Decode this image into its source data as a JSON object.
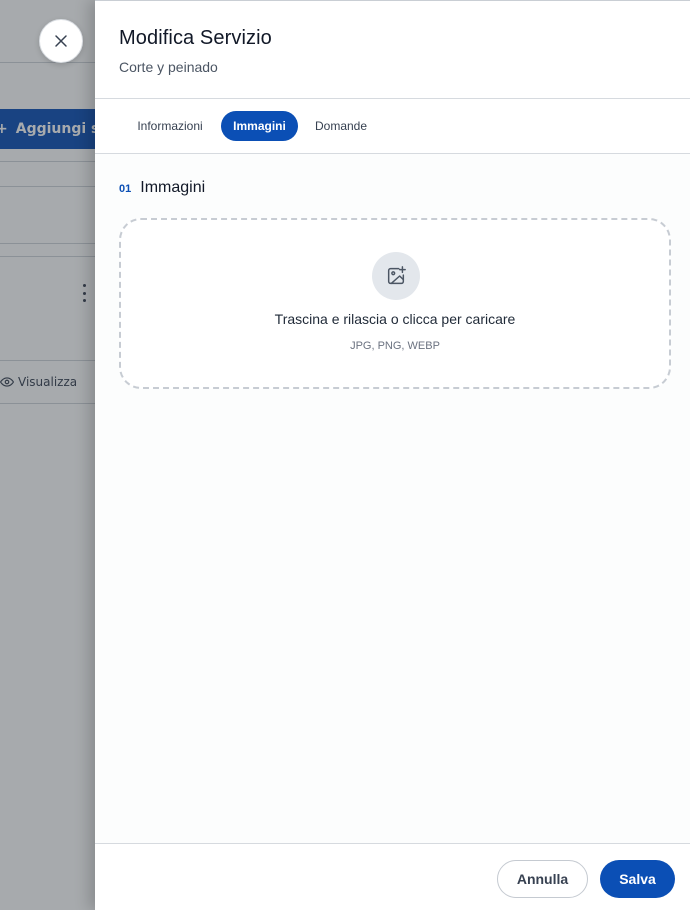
{
  "background": {
    "add_button_label": "Aggiungi se",
    "view_label": "Visualizza"
  },
  "drawer": {
    "title": "Modifica Servizio",
    "subtitle": "Corte y peinado",
    "tabs": [
      {
        "label": "Informazioni",
        "active": false
      },
      {
        "label": "Immagini",
        "active": true
      },
      {
        "label": "Domande",
        "active": false
      }
    ],
    "section": {
      "number": "01",
      "title": "Immagini"
    },
    "dropzone": {
      "text": "Trascina e rilascia o clicca per caricare",
      "hint": "JPG, PNG, WEBP",
      "icon": "image-plus-icon"
    },
    "footer": {
      "cancel_label": "Annulla",
      "save_label": "Salva"
    }
  },
  "colors": {
    "accent": "#0b4fb5",
    "overlay": "rgba(45,52,60,0.42)"
  }
}
